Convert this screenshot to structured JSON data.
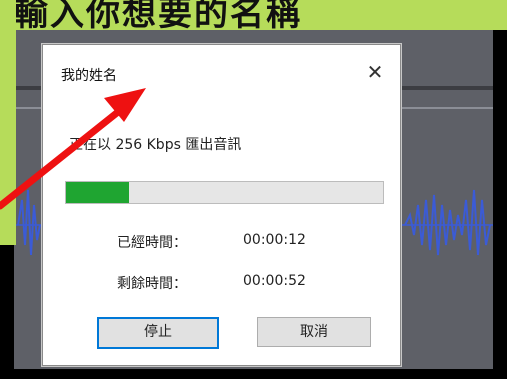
{
  "dialog": {
    "title": "我的姓名",
    "close_glyph": "✕",
    "status": "正在以 256 Kbps 匯出音訊",
    "progress": 0.2,
    "elapsed_label": "已經時間：",
    "elapsed_value": "00:00:12",
    "remaining_label": "剩餘時間：",
    "remaining_value": "00:00:52",
    "stop_label": "停止",
    "cancel_label": "取消"
  },
  "colors": {
    "banner": "#b6dc5a",
    "progress_fill": "#1fa531",
    "arrow": "#ee1111",
    "waveform": "#3b5bd6"
  },
  "icons": {
    "close": "close-icon",
    "arrow": "red-arrow"
  }
}
